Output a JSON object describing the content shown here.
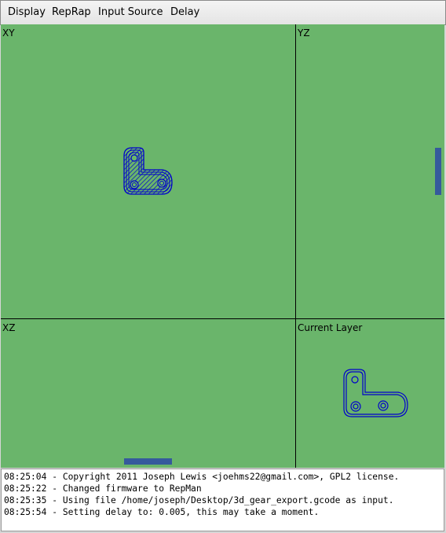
{
  "menu": {
    "items": [
      "Display",
      "RepRap",
      "Input Source",
      "Delay"
    ]
  },
  "viewports": {
    "xy": "XY",
    "yz": "YZ",
    "xz": "XZ",
    "current_layer": "Current Layer"
  },
  "log": {
    "lines": [
      "08:25:04 - Copyright 2011 Joseph Lewis <joehms22@gmail.com>, GPL2 license.",
      "08:25:22 - Changed firmware to RepMan",
      "08:25:35 - Using file /home/joseph/Desktop/3d_gear_export.gcode as input.",
      "08:25:54 - Setting delay to: 0.005, this may take a moment."
    ]
  },
  "colors": {
    "background": "#6ab56b",
    "toolpath": "#0000cc",
    "divider": "#000000"
  }
}
